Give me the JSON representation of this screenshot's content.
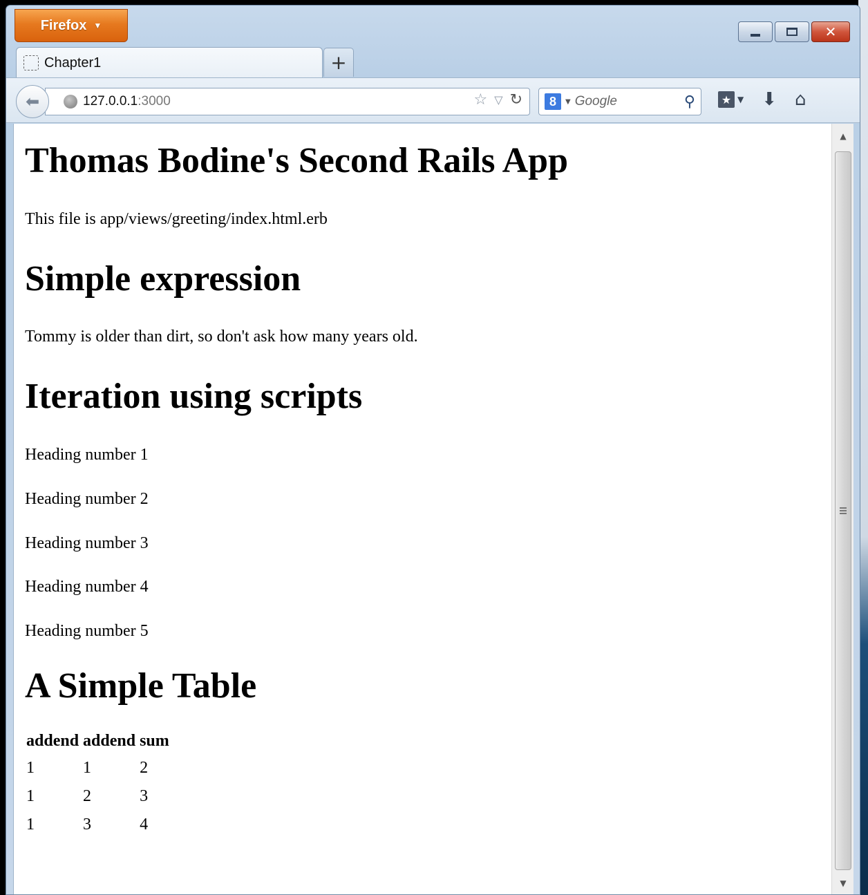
{
  "browser": {
    "app_button": "Firefox",
    "tab_title": "Chapter1",
    "new_tab": "+",
    "url_host": "127.0.0.1",
    "url_port": ":3000",
    "search_placeholder": "Google",
    "search_engine_badge": "8"
  },
  "page": {
    "title": "Thomas Bodine's Second Rails App",
    "file_note": "This file is app/views/greeting/index.html.erb",
    "section_expression": "Simple expression",
    "expression_text": "Tommy is older than dirt, so don't ask how many years old.",
    "section_iteration": "Iteration using scripts",
    "headings": [
      "Heading number 1",
      "Heading number 2",
      "Heading number 3",
      "Heading number 4",
      "Heading number 5"
    ],
    "section_table": "A Simple Table",
    "table": {
      "headers": [
        "addend",
        "addend",
        "sum"
      ],
      "rows": [
        [
          "1",
          "1",
          "2"
        ],
        [
          "1",
          "2",
          "3"
        ],
        [
          "1",
          "3",
          "4"
        ]
      ]
    }
  },
  "icons": {
    "back": "back-arrow-icon",
    "globe": "globe-icon",
    "bookmark_star": "star-icon",
    "history_dropdown": "dropdown-arrow-icon",
    "reload": "reload-icon",
    "search": "search-icon",
    "bookmarks": "bookmarks-menu-icon",
    "downloads": "download-arrow-icon",
    "home": "home-icon"
  }
}
